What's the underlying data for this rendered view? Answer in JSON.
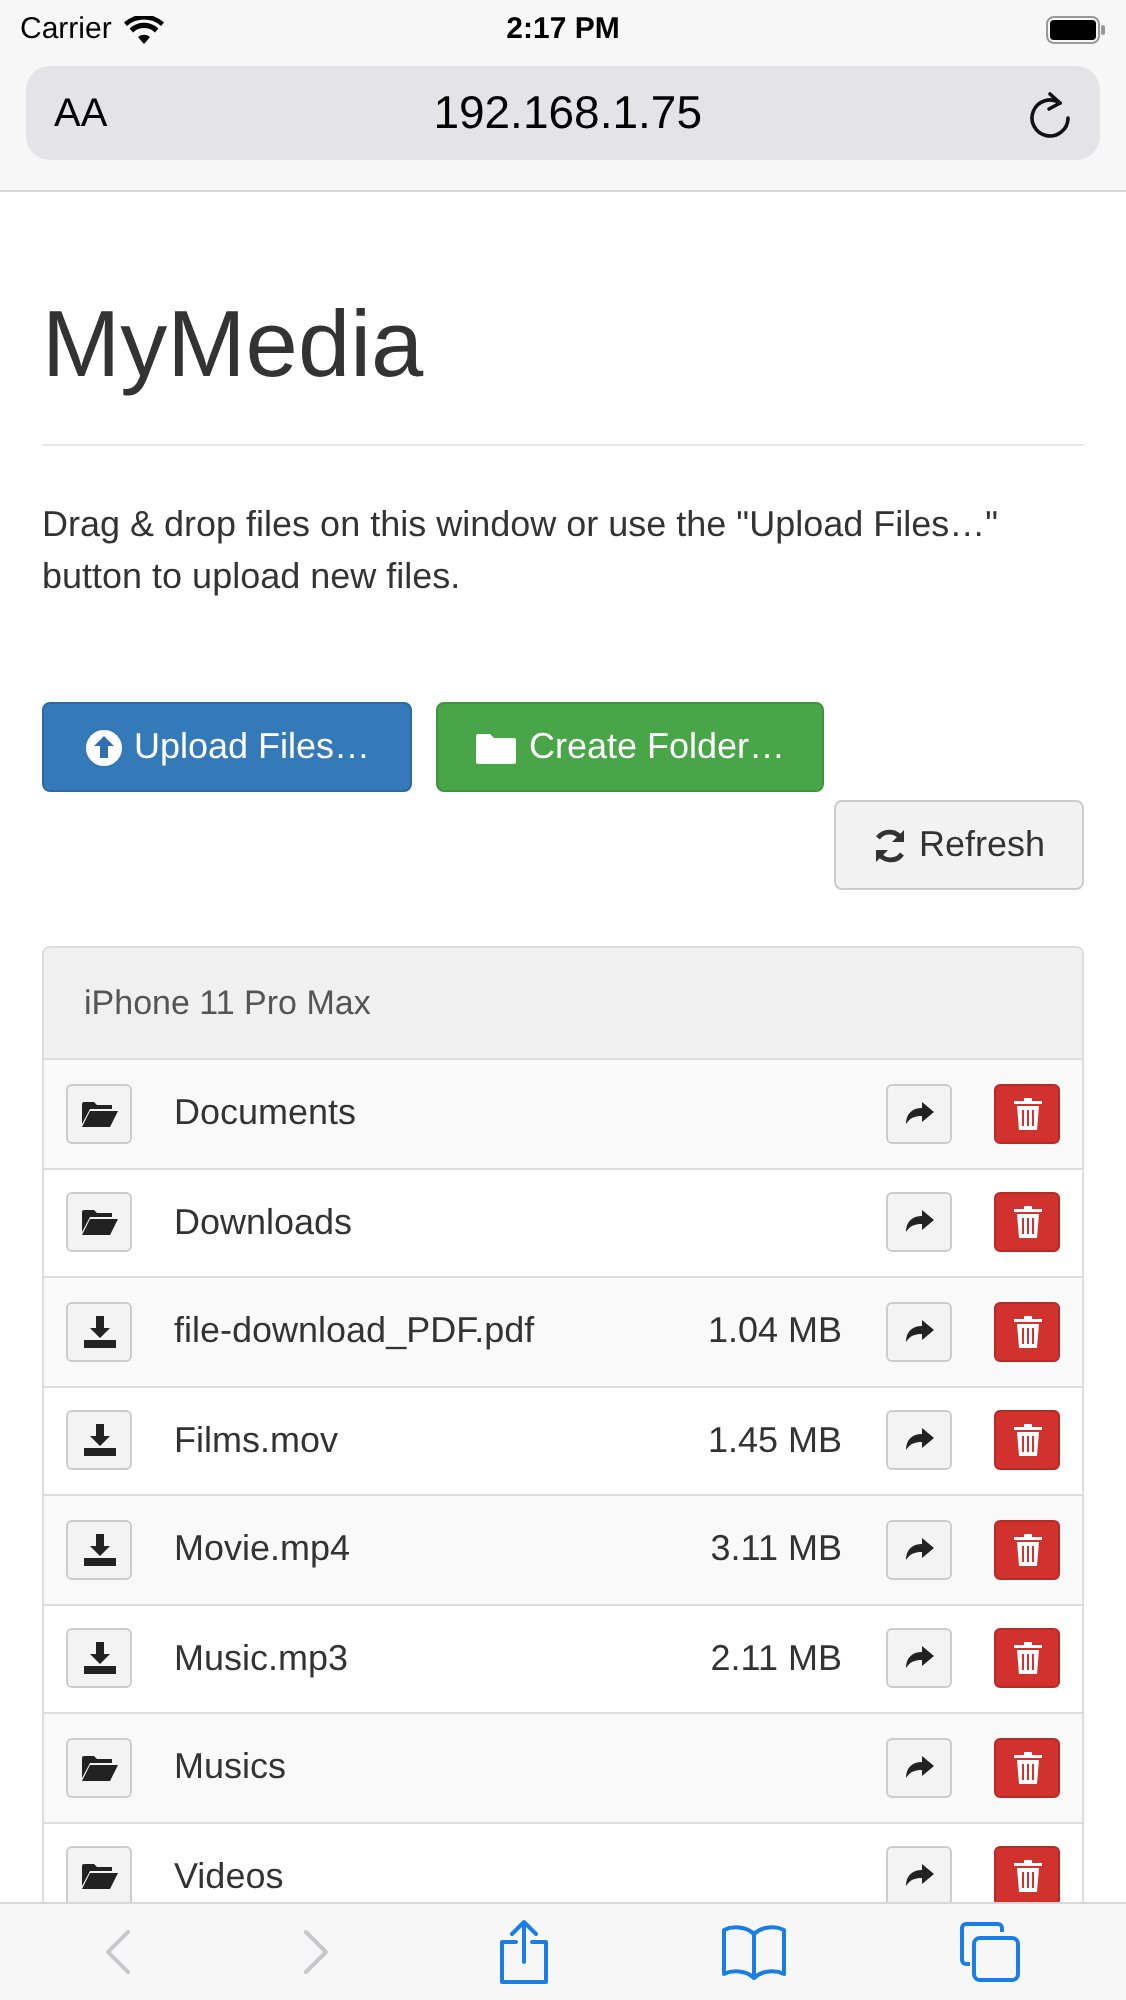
{
  "status_bar": {
    "carrier": "Carrier",
    "time": "2:17 PM"
  },
  "address_bar": {
    "text_size": "AA",
    "url": "192.168.1.75"
  },
  "title": "MyMedia",
  "intro": "Drag & drop files on this window or use the \"Upload Files…\" button to upload new files.",
  "buttons": [
    {
      "kind": "upload",
      "label": "Upload Files…"
    },
    {
      "kind": "folder",
      "label": "Create Folder…"
    },
    {
      "kind": "refresh",
      "label": "Refresh"
    }
  ],
  "panel": {
    "heading": "iPhone 11 Pro Max",
    "items": [
      {
        "kind": "folder",
        "name": "Documents"
      },
      {
        "kind": "folder",
        "name": "Downloads"
      },
      {
        "kind": "file",
        "name": "file-download_PDF.pdf",
        "size": "1.04 MB"
      },
      {
        "kind": "file",
        "name": "Films.mov",
        "size": "1.45 MB"
      },
      {
        "kind": "file",
        "name": "Movie.mp4",
        "size": "3.11 MB"
      },
      {
        "kind": "file",
        "name": "Music.mp3",
        "size": "2.11 MB"
      },
      {
        "kind": "folder",
        "name": "Musics"
      },
      {
        "kind": "folder",
        "name": "Videos"
      }
    ]
  },
  "toolbar": {
    "back_disabled": true,
    "forward_disabled": true
  }
}
